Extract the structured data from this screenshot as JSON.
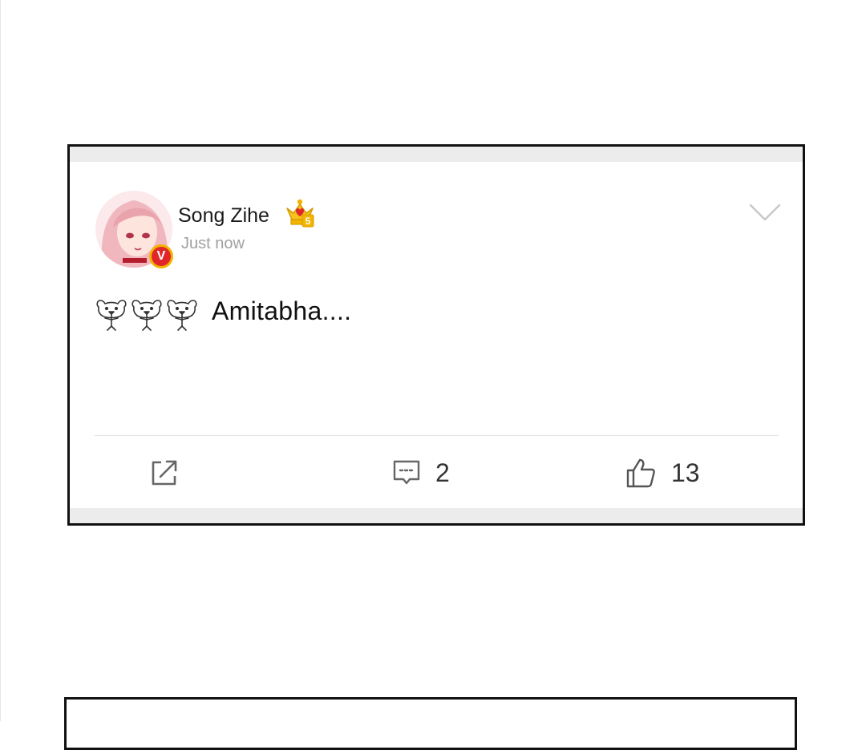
{
  "post": {
    "username": "Song Zihe",
    "timestamp": "Just now",
    "verified_badge": "V",
    "level_badge": "5",
    "emoji_icons": [
      "bear-hug-icon",
      "bear-hug-icon",
      "bear-hug-icon"
    ],
    "text": "Amitabha....",
    "actions": {
      "share_icon": "share-icon",
      "comments_count": "2",
      "likes_count": "13"
    }
  },
  "colors": {
    "verified_red": "#e0262b",
    "verified_ring": "#f2b400",
    "crown_gold": "#f2b400",
    "timestamp_gray": "#a0a0a0",
    "panel_border": "#111111"
  }
}
